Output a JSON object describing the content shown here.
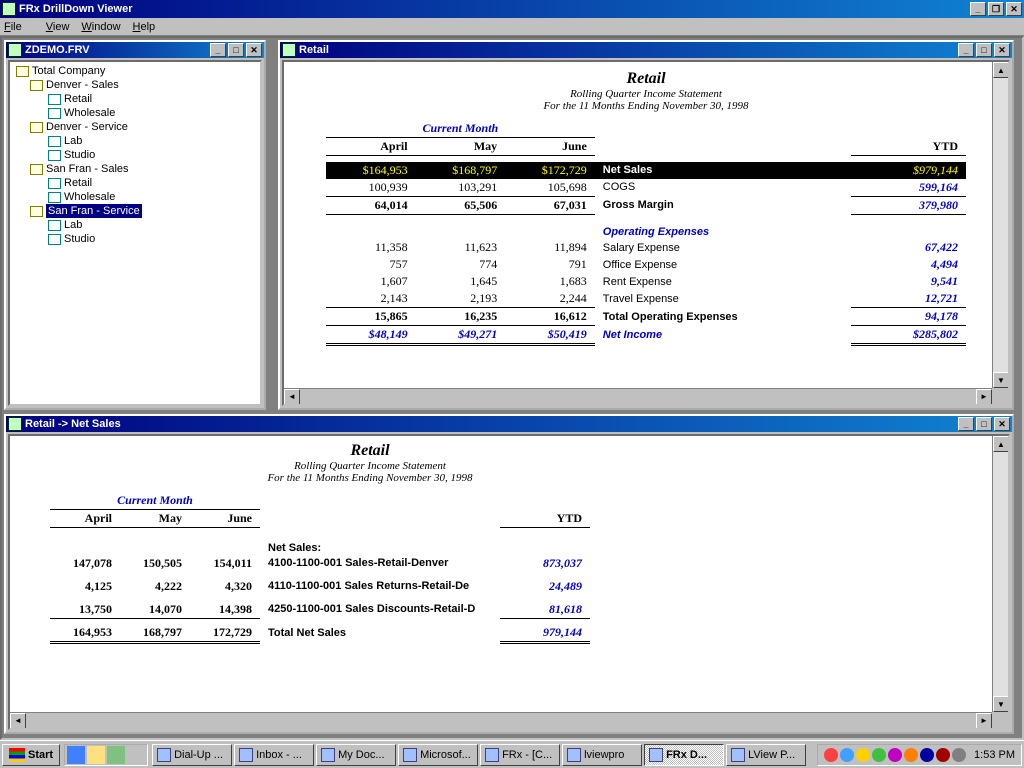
{
  "app_title": "FRx DrillDown Viewer",
  "menu": {
    "file": "File",
    "view": "View",
    "window": "Window",
    "help": "Help"
  },
  "tree_window": {
    "title": "ZDEMO.FRV"
  },
  "tree": {
    "root": "Total Company",
    "nodes": [
      {
        "label": "Denver - Sales",
        "children": [
          "Retail",
          "Wholesale"
        ]
      },
      {
        "label": "Denver - Service",
        "children": [
          "Lab",
          "Studio"
        ]
      },
      {
        "label": "San Fran - Sales",
        "children": [
          "Retail",
          "Wholesale"
        ]
      },
      {
        "label": "San Fran - Service",
        "children": [
          "Lab",
          "Studio"
        ],
        "selected": true
      }
    ]
  },
  "retail_window": {
    "title": "Retail"
  },
  "retail_report": {
    "title": "Retail",
    "sub1": "Rolling Quarter Income Statement",
    "sub2": "For the 11 Months Ending  November 30, 1998",
    "cm_header": "Current Month",
    "cols": [
      "April",
      "May",
      "June"
    ],
    "ytd_col": "YTD",
    "rows": {
      "net_sales": {
        "label": "Net Sales",
        "apr": "$164,953",
        "may": "$168,797",
        "jun": "$172,729",
        "ytd": "$979,144"
      },
      "cogs": {
        "label": "COGS",
        "apr": "100,939",
        "may": "103,291",
        "jun": "105,698",
        "ytd": "599,164"
      },
      "gross_margin": {
        "label": "Gross Margin",
        "apr": "64,014",
        "may": "65,506",
        "jun": "67,031",
        "ytd": "379,980"
      },
      "opex_hdr": "Operating Expenses",
      "salary": {
        "label": "Salary Expense",
        "apr": "11,358",
        "may": "11,623",
        "jun": "11,894",
        "ytd": "67,422"
      },
      "office": {
        "label": "Office Expense",
        "apr": "757",
        "may": "774",
        "jun": "791",
        "ytd": "4,494"
      },
      "rent": {
        "label": "Rent Expense",
        "apr": "1,607",
        "may": "1,645",
        "jun": "1,683",
        "ytd": "9,541"
      },
      "travel": {
        "label": "Travel Expense",
        "apr": "2,143",
        "may": "2,193",
        "jun": "2,244",
        "ytd": "12,721"
      },
      "total_opex": {
        "label": "Total Operating Expenses",
        "apr": "15,865",
        "may": "16,235",
        "jun": "16,612",
        "ytd": "94,178"
      },
      "net_income": {
        "label": "Net Income",
        "apr": "$48,149",
        "may": "$49,271",
        "jun": "$50,419",
        "ytd": "$285,802"
      }
    }
  },
  "drill_window": {
    "title": "Retail -> Net Sales"
  },
  "drill_report": {
    "title": "Retail",
    "sub1": "Rolling Quarter Income Statement",
    "sub2": "For the 11 Months Ending  November 30, 1998",
    "cm_header": "Current Month",
    "cols": [
      "April",
      "May",
      "June"
    ],
    "ytd_col": "YTD",
    "section": "Net Sales:",
    "rows": {
      "r1": {
        "label": "4100-1100-001 Sales-Retail-Denver",
        "apr": "147,078",
        "may": "150,505",
        "jun": "154,011",
        "ytd": "873,037"
      },
      "r2": {
        "label": "4110-1100-001 Sales Returns-Retail-De",
        "apr": "4,125",
        "may": "4,222",
        "jun": "4,320",
        "ytd": "24,489"
      },
      "r3": {
        "label": "4250-1100-001 Sales Discounts-Retail-D",
        "apr": "13,750",
        "may": "14,070",
        "jun": "14,398",
        "ytd": "81,618"
      },
      "total": {
        "label": "Total Net Sales",
        "apr": "164,953",
        "may": "168,797",
        "jun": "172,729",
        "ytd": "979,144"
      }
    }
  },
  "taskbar": {
    "start": "Start",
    "items": [
      "Dial-Up ...",
      "Inbox - ...",
      "My Doc...",
      "Microsof...",
      "FRx  - [C...",
      "lviewpro",
      "FRx D...",
      "LView P..."
    ],
    "active_index": 6,
    "clock": "1:53 PM"
  }
}
